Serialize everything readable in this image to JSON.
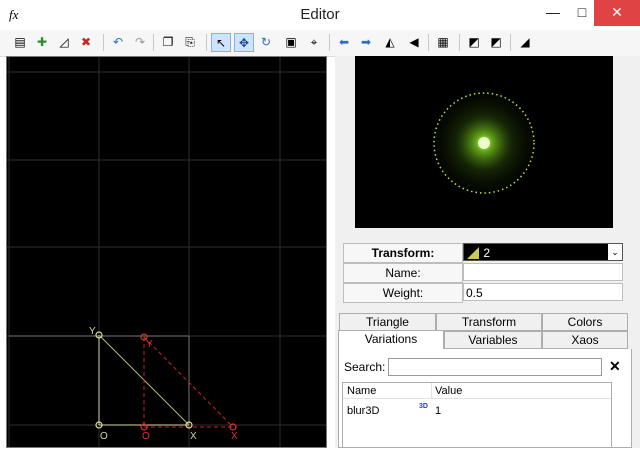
{
  "window": {
    "app_icon": "fx",
    "title": "Editor",
    "minimize": "—",
    "maximize": "□",
    "close": "✕"
  },
  "toolbar": {
    "items": [
      {
        "name": "new-icon",
        "glyph": "▤"
      },
      {
        "name": "add-transform-icon",
        "glyph": "✚"
      },
      {
        "name": "duplicate-transform-icon",
        "glyph": "◿"
      },
      {
        "name": "delete-transform-icon",
        "glyph": "✖"
      },
      {
        "name": "undo-icon",
        "glyph": "↶"
      },
      {
        "name": "redo-icon",
        "glyph": "↷"
      },
      {
        "name": "copy-icon",
        "glyph": "❐"
      },
      {
        "name": "paste-icon",
        "glyph": "⎘"
      },
      {
        "name": "select-mode-icon",
        "glyph": "↖"
      },
      {
        "name": "move-mode-icon",
        "glyph": "✥"
      },
      {
        "name": "rotate-mode-icon",
        "glyph": "↻"
      },
      {
        "name": "scale-mode-icon",
        "glyph": "▣"
      },
      {
        "name": "fit-view-icon",
        "glyph": "⌖"
      },
      {
        "name": "rotate-left-icon",
        "glyph": "⬅"
      },
      {
        "name": "rotate-right-icon",
        "glyph": "➡"
      },
      {
        "name": "flip-horizontal-icon",
        "glyph": "◭"
      },
      {
        "name": "flip-vertical-icon",
        "glyph": "◀"
      },
      {
        "name": "grid-icon",
        "glyph": "▦"
      },
      {
        "name": "post-transform-icon",
        "glyph": "◩"
      },
      {
        "name": "reset-post-transform-icon",
        "glyph": "◩"
      },
      {
        "name": "final-transform-icon",
        "glyph": "◢"
      }
    ]
  },
  "triangle_editor": {
    "labels": {
      "ref_y": "Y",
      "ref_o": "O",
      "ref_x": "X",
      "sel_y": "Y",
      "sel_o": "O",
      "sel_x": "X"
    },
    "colors": {
      "grid": "#2e2e2e",
      "reference": "#b9b96a",
      "selected": "#cc2222"
    }
  },
  "preview": {
    "colors": {
      "ring": "#b6e04a",
      "glow": "#7dd51e",
      "center": "#e9ffb0"
    }
  },
  "transform_panel": {
    "transform_label": "Transform:",
    "transform_value": "2",
    "name_label": "Name:",
    "name_value": "",
    "weight_label": "Weight:",
    "weight_value": "0.5"
  },
  "tabs": {
    "row1": [
      "Triangle",
      "Transform",
      "Colors"
    ],
    "row2": [
      "Variations",
      "Variables",
      "Xaos"
    ],
    "selected": "Variations"
  },
  "variations": {
    "search_label": "Search:",
    "search_value": "",
    "clear_label": "✕",
    "columns": [
      "Name",
      "Value"
    ],
    "rows": [
      {
        "name": "blur3D",
        "badge": "3D",
        "value": "1"
      }
    ]
  }
}
